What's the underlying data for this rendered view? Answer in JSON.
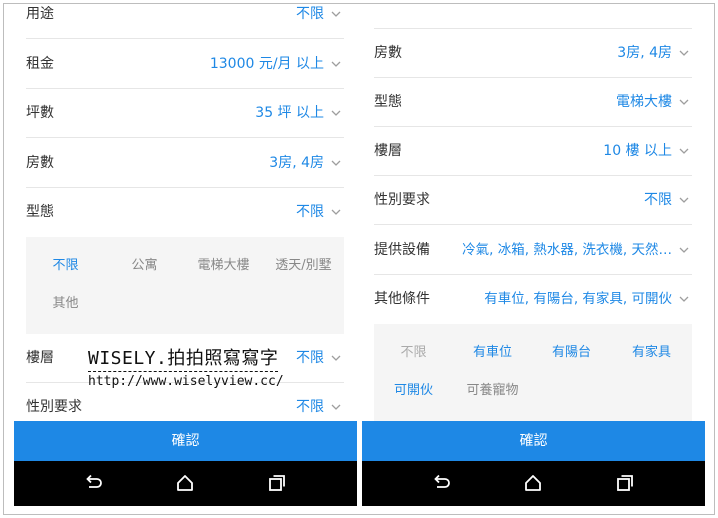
{
  "left_screen": {
    "rows_top": [
      {
        "label": "用途",
        "value": "不限"
      },
      {
        "label": "租金",
        "value": "13000 元/月 以上"
      },
      {
        "label": "坪數",
        "value": "35 坪 以上"
      },
      {
        "label": "房數",
        "value": "3房, 4房"
      },
      {
        "label": "型態",
        "value": "不限"
      }
    ],
    "type_options": [
      {
        "label": "不限",
        "state": "selected"
      },
      {
        "label": "公寓",
        "state": "unselected"
      },
      {
        "label": "電梯大樓",
        "state": "unselected"
      },
      {
        "label": "透天/別墅",
        "state": "unselected"
      },
      {
        "label": "其他",
        "state": "unselected"
      }
    ],
    "rows_bottom": [
      {
        "label": "樓層",
        "value": "不限"
      },
      {
        "label": "性別要求",
        "value": "不限"
      }
    ],
    "confirm_label": "確認"
  },
  "right_screen": {
    "rows": [
      {
        "label": "房數",
        "value": "3房, 4房"
      },
      {
        "label": "型態",
        "value": "電梯大樓"
      },
      {
        "label": "樓層",
        "value": "10 樓 以上"
      },
      {
        "label": "性別要求",
        "value": "不限"
      },
      {
        "label": "提供設備",
        "value": "冷氣, 冰箱, 熱水器, 洗衣機, 天然…"
      },
      {
        "label": "其他條件",
        "value": "有車位, 有陽台, 有家具, 可開伙"
      }
    ],
    "condition_options": [
      {
        "label": "不限",
        "state": "disabled"
      },
      {
        "label": "有車位",
        "state": "selected"
      },
      {
        "label": "有陽台",
        "state": "selected"
      },
      {
        "label": "有家具",
        "state": "selected"
      },
      {
        "label": "可開伙",
        "state": "selected"
      },
      {
        "label": "可養寵物",
        "state": "unselected"
      }
    ],
    "confirm_label": "確認"
  },
  "watermark": {
    "title": "WISELY.拍拍照寫寫字",
    "url": "http://www.wiselyview.cc/"
  },
  "colors": {
    "accent": "#1e88e5",
    "label_text": "#333333",
    "chip_panel": "#f5f5f5",
    "navbar": "#000000"
  },
  "icons": {
    "row_chevron": "chevron-down-icon",
    "nav_back": "back-icon",
    "nav_home": "home-icon",
    "nav_recent": "recent-apps-icon"
  }
}
